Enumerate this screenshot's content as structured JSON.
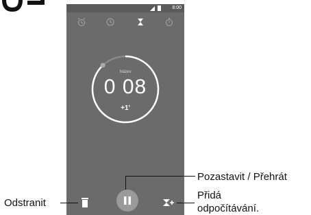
{
  "status_bar": {
    "time": "8:00"
  },
  "tabs": [
    {
      "name": "alarm",
      "icon": "alarm-clock-icon"
    },
    {
      "name": "clock",
      "icon": "clock-icon"
    },
    {
      "name": "timer",
      "icon": "hourglass-icon",
      "active": true
    },
    {
      "name": "stopwatch",
      "icon": "stopwatch-icon"
    }
  ],
  "timer": {
    "name_label": "Název",
    "value": "0 08",
    "add_minute_label": "+1'",
    "progress": 0.88
  },
  "controls": {
    "delete_icon": "trash-icon",
    "pause_icon": "pause-icon",
    "add_icon": "add-timer-icon"
  },
  "callouts": {
    "pause_play": "Pozastavit / Přehrát",
    "delete": "Odstranit",
    "add_line1": "Přidá",
    "add_line2": "odpočítávání."
  },
  "colors": {
    "screen_bg": "#6b6b6b",
    "status_bar_bg": "#5a5a5a",
    "ring": "#ffffff",
    "ring_track": "#8a8a8a",
    "pause_button": "#9a9a9a"
  }
}
